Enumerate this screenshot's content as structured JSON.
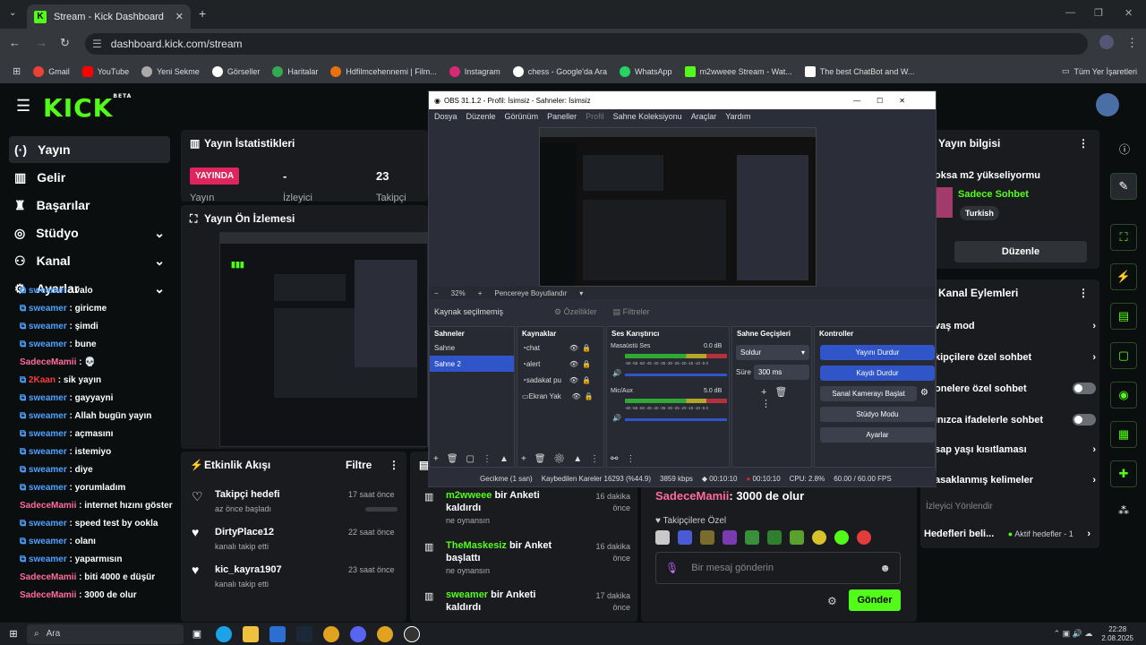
{
  "browser": {
    "tab_title": "Stream - Kick Dashboard",
    "url": "dashboard.kick.com/stream",
    "bookmarks": [
      "Gmail",
      "YouTube",
      "Yeni Sekme",
      "Görseller",
      "Haritalar",
      "Hdfilmcehennemi | Film...",
      "Instagram",
      "chess - Google'da Ara",
      "WhatsApp",
      "m2wweee Stream - Wat...",
      "The best ChatBot and W..."
    ],
    "all_bookmarks": "Tüm Yer İşaretleri"
  },
  "kick": {
    "logo": "KICK",
    "beta": "BETA"
  },
  "nav": [
    {
      "label": "Yayın"
    },
    {
      "label": "Gelir"
    },
    {
      "label": "Başarılar"
    },
    {
      "label": "Stüdyo"
    },
    {
      "label": "Kanal"
    },
    {
      "label": "Ayarlar"
    }
  ],
  "stats": {
    "title": "Yayın İstatistikleri",
    "live": "YAYINDA",
    "live_sub": "Yayın",
    "viewers_val": "-",
    "viewers_label": "İzleyici",
    "followers_val": "23",
    "followers_label": "Takipçi"
  },
  "preview": {
    "title": "Yayın Ön İzlemesi"
  },
  "chat": [
    {
      "user": "sweamer",
      "msg": "valo",
      "c": "b"
    },
    {
      "user": "sweamer",
      "msg": "giricme",
      "c": "b"
    },
    {
      "user": "sweamer",
      "msg": "şimdi",
      "c": "b"
    },
    {
      "user": "sweamer",
      "msg": "bune",
      "c": "b"
    },
    {
      "user": "SadeceMamii",
      "msg": "💀",
      "c": "p"
    },
    {
      "user": "2Kaan",
      "msg": "sik yayın",
      "c": "r"
    },
    {
      "user": "sweamer",
      "msg": "gayyayni",
      "c": "b"
    },
    {
      "user": "sweamer",
      "msg": "Allah bugün yayın",
      "c": "b"
    },
    {
      "user": "sweamer",
      "msg": "açmasını",
      "c": "b"
    },
    {
      "user": "sweamer",
      "msg": "istemiyo",
      "c": "b"
    },
    {
      "user": "sweamer",
      "msg": "diye",
      "c": "b"
    },
    {
      "user": "sweamer",
      "msg": "yorumladım",
      "c": "b"
    },
    {
      "user": "SadeceMamii",
      "msg": "internet hızını göster",
      "c": "p"
    },
    {
      "user": "sweamer",
      "msg": "speed test by ookla",
      "c": "b"
    },
    {
      "user": "sweamer",
      "msg": "olanı",
      "c": "b"
    },
    {
      "user": "sweamer",
      "msg": "yaparmısın",
      "c": "b"
    },
    {
      "user": "SadeceMamii",
      "msg": "biti 4000 e düşür",
      "c": "p"
    },
    {
      "user": "SadeceMamii",
      "msg": "3000 de olur",
      "c": "p"
    }
  ],
  "events": {
    "title": "Etkinlik Akışı",
    "filter": "Filtre",
    "items": [
      {
        "title": "Takipçi hedefi",
        "sub": "az önce başladı",
        "time": "17 saat önce"
      },
      {
        "title": "DirtyPlace12",
        "sub": "kanalı takip etti",
        "time": "22 saat önce"
      },
      {
        "title": "kic_kayra1907",
        "sub": "kanalı takip etti",
        "time": "23 saat önce"
      }
    ]
  },
  "polls": [
    {
      "user": "m2wweee",
      "rest": "bir Anketi kaldırdı",
      "sub": "ne oynansın",
      "time": "16 dakika önce"
    },
    {
      "user": "TheMaskesiz",
      "rest": "bir Anket başlattı",
      "sub": "ne oynansın",
      "time": "16 dakika önce"
    },
    {
      "user": "sweamer",
      "rest": "bir Anketi kaldırdı",
      "sub": "",
      "time": "17 dakika önce"
    }
  ],
  "chatbox": {
    "last_user": "SadeceMamii",
    "last_msg": ": 3000 de olur",
    "followers_only": "Takipçilere Özel",
    "placeholder": "Bir mesaj gönderin",
    "send": "Gönder"
  },
  "info": {
    "title": "Yayın bilgisi",
    "stream_title": "oksa m2 yükseliyormu",
    "category": "Sadece Sohbet",
    "tag": "Turkish",
    "edit": "Düzenle"
  },
  "actions": {
    "title": "Kanal Eylemleri",
    "rows": [
      "vaş mod",
      "kipçilere özel sohbet",
      "onelere özel sohbet",
      "ınızca ifadelerle sohbet",
      "sap yaşı kısıtlaması",
      "asaklanmış kelimeler"
    ],
    "redirect": "İzleyici Yönlendir",
    "goals": "Hedefleri beli...",
    "goals_state": "Aktif hedefler - 1"
  },
  "obs": {
    "title": "OBS 31.1.2 - Profil: İsimsiz - Sahneler: İsimsiz",
    "menu": [
      "Dosya",
      "Düzenle",
      "Görünüm",
      "Paneller",
      "Profil",
      "Sahne Koleksiyonu",
      "Araçlar",
      "Yardım"
    ],
    "zoom": "32%",
    "fit": "Pencereye Boyutlandır",
    "no_source": "Kaynak seçilmemiş",
    "props": "Özellikler",
    "filters": "Filtreler",
    "scenes_title": "Sahneler",
    "scenes": [
      "Sahne",
      "Sahne 2"
    ],
    "sources_title": "Kaynaklar",
    "sources": [
      "chat",
      "alert",
      "sadakat pu",
      "Ekran Yak"
    ],
    "mixer_title": "Ses Karıştırıcı",
    "ch1": "Masaüstü Ses",
    "ch1_db": "0.0 dB",
    "ch2": "Mic/Aux",
    "ch2_db": "5.0 dB",
    "scale": "-60 -55 -50 -45 -40 -35 -30 -25 -20 -15 -10 -5 0",
    "trans_title": "Sahne Geçişleri",
    "trans": "Soldur",
    "dur_label": "Süre",
    "dur": "300 ms",
    "ctrl_title": "Kontroller",
    "stop_stream": "Yayını Durdur",
    "stop_rec": "Kaydı Durdur",
    "vcam": "Sanal Kamerayı Başlat",
    "studio": "Stüdyo Modu",
    "settings": "Ayarlar",
    "status": {
      "delay": "Gecikme (1 san)",
      "dropped": "Kaybedilen Kareler 16293 (%44.9)",
      "kbps": "3859 kbps",
      "t1": "00:10:10",
      "t2": "00:10:10",
      "cpu": "CPU: 2.8%",
      "fps": "60.00 / 60.00 FPS"
    }
  },
  "taskbar": {
    "search": "Ara",
    "time": "22:28",
    "date": "2.08.2025"
  }
}
